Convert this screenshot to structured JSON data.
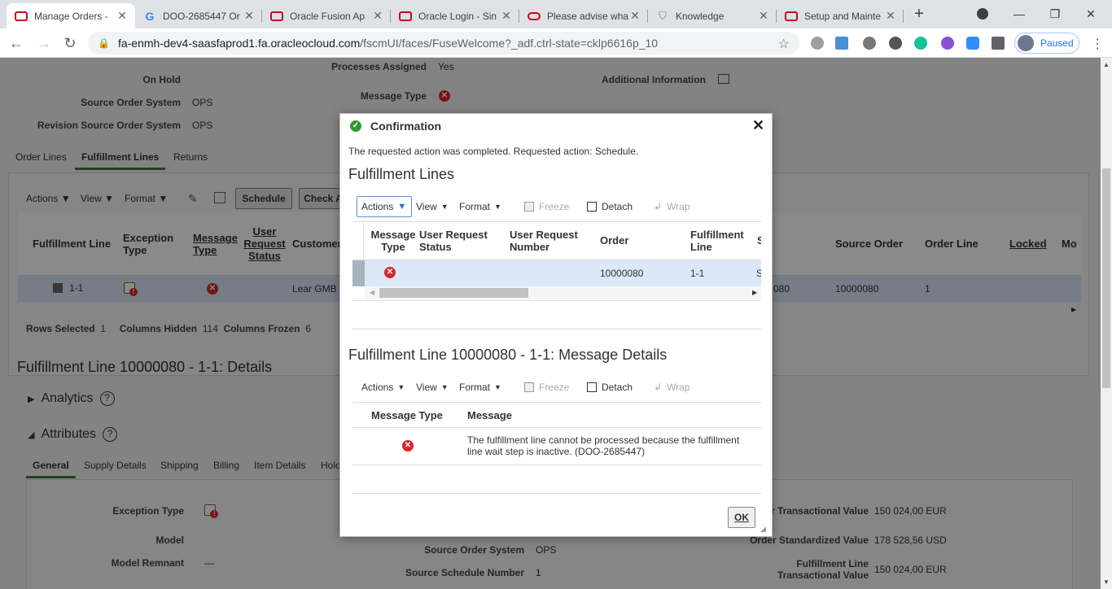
{
  "browser": {
    "tabs": [
      {
        "title": "Manage Orders -",
        "favicon": "oracle-icon",
        "active": true
      },
      {
        "title": "DOO-2685447 Or",
        "favicon": "google-icon",
        "active": false
      },
      {
        "title": "Oracle Fusion Ap",
        "favicon": "oracle-icon",
        "active": false
      },
      {
        "title": "Oracle Login - Sin",
        "favicon": "oracle-icon",
        "active": false
      },
      {
        "title": "Please advise wha",
        "favicon": "oracle-oval-icon",
        "active": false
      },
      {
        "title": "Knowledge",
        "favicon": "shield-icon",
        "active": false
      },
      {
        "title": "Setup and Mainte",
        "favicon": "oracle-icon",
        "active": false
      }
    ],
    "new_tab": "+",
    "url_host": "fa-enmh-dev4-saasfaprod1.fa.oracleocloud.com",
    "url_path": "/fscmUI/faces/FuseWelcome?_adf.ctrl-state=cklp6616p_10",
    "profile_label": "Paused"
  },
  "page": {
    "header_fields": {
      "processes_assigned_label": "Processes Assigned",
      "processes_assigned_value": "Yes",
      "on_hold_label": "On Hold",
      "message_type_label": "Message Type",
      "additional_info_label": "Additional Information",
      "source_order_system_label": "Source Order System",
      "source_order_system_value": "OPS",
      "revision_source_label": "Revision Source Order System",
      "revision_source_value": "OPS"
    },
    "tabs": [
      "Order Lines",
      "Fulfillment Lines",
      "Returns"
    ],
    "toolbar": {
      "actions": "Actions",
      "view": "View",
      "format": "Format",
      "schedule": "Schedule",
      "check": "Check A"
    },
    "columns": {
      "fulfillment_line": "Fulfillment Line",
      "exception_type": "Exception Type",
      "message_type": "Message Type",
      "user_request_status": "User Request Status",
      "customer": "Customer",
      "source_order": "Source Order",
      "order_line": "Order Line",
      "locked": "Locked",
      "mod": "Mo"
    },
    "row": {
      "fulfillment_line": "1-1",
      "customer": "Lear GMB",
      "partial": "080",
      "source_order": "10000080",
      "order_line": "1"
    },
    "footer": {
      "rows_selected_label": "Rows Selected",
      "rows_selected": "1",
      "columns_hidden_label": "Columns Hidden",
      "columns_hidden": "114",
      "columns_frozen_label": "Columns Frozen",
      "columns_frozen": "6"
    },
    "details_title": "Fulfillment Line 10000080 - 1-1: Details",
    "analytics": "Analytics",
    "attributes": "Attributes",
    "subtabs": [
      "General",
      "Supply Details",
      "Shipping",
      "Billing",
      "Item Details",
      "Hold"
    ],
    "general": {
      "exception_type_label": "Exception Type",
      "model_label": "Model",
      "model_remnant_label": "Model Remnant",
      "model_remnant_value": "—",
      "source_order_system_label": "Source Order System",
      "source_order_system_value": "OPS",
      "source_schedule_number_label": "Source Schedule Number",
      "source_schedule_number_value": "1",
      "transactional_value_label": "r Transactional Value",
      "transactional_value": "150 024,00",
      "transactional_currency": "EUR",
      "standardized_value_label": "Order Standardized Value",
      "standardized_value": "178 528,56",
      "standardized_currency": "USD",
      "fl_transactional_label_1": "Fulfillment Line",
      "fl_transactional_label_2": "Transactional Value",
      "fl_transactional_value": "150 024,00",
      "fl_transactional_currency": "EUR"
    }
  },
  "dialog": {
    "title": "Confirmation",
    "message": "The requested action was completed. Requested action: Schedule.",
    "section1_title": "Fulfillment Lines",
    "toolbar": {
      "actions": "Actions",
      "view": "View",
      "format": "Format",
      "freeze": "Freeze",
      "detach": "Detach",
      "wrap": "Wrap"
    },
    "grid1_headers": {
      "message_type": "Message Type",
      "user_request_status": "User Request Status",
      "user_request_number": "User Request Number",
      "order": "Order",
      "fulfillment_line": "Fulfillment Line",
      "partial": "S"
    },
    "grid1_row": {
      "order": "10000080",
      "fulfillment_line": "1-1",
      "partial": "S"
    },
    "section2_title": "Fulfillment Line 10000080 - 1-1: Message Details",
    "grid2_headers": {
      "message_type": "Message Type",
      "message": "Message"
    },
    "grid2_row": {
      "message_line1": "The fulfillment line cannot be processed because the fulfillment",
      "message_line2": "line wait step is inactive. (DOO-2685447)"
    },
    "ok_label": "OK"
  },
  "colors": {
    "error": "#d9262c",
    "success": "#2e9b2e",
    "selected_row": "#dbe8f7",
    "tab_underline": "#3a7a3a"
  }
}
